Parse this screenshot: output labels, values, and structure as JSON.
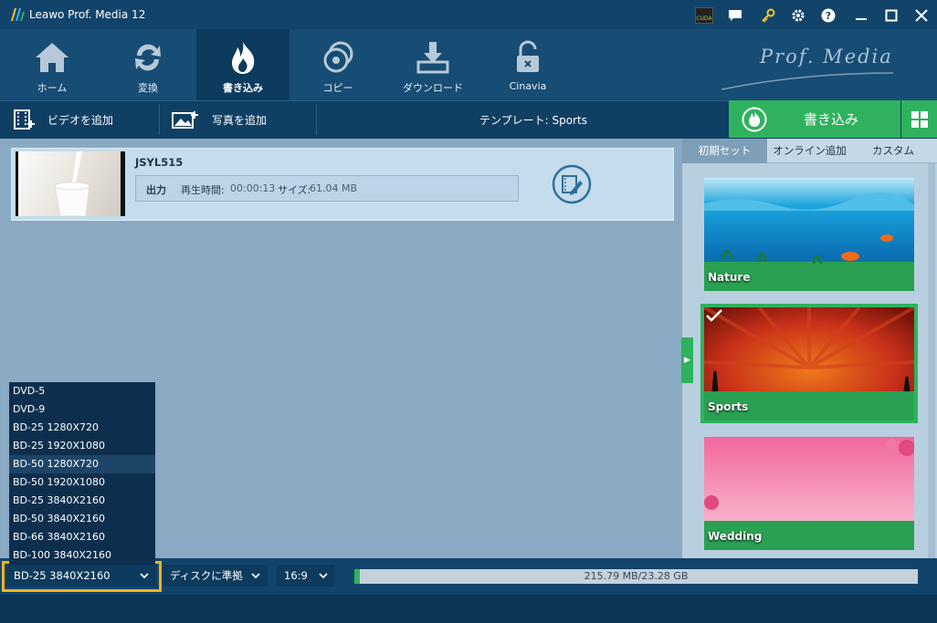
{
  "window": {
    "title": "Leawo Prof. Media 12",
    "cuda_label": "CUDA",
    "brand": "Prof. Media"
  },
  "nav": {
    "items": [
      {
        "label": "ホーム"
      },
      {
        "label": "変換"
      },
      {
        "label": "書き込み"
      },
      {
        "label": "コピー"
      },
      {
        "label": "ダウンロード"
      },
      {
        "label": "Cinavia"
      }
    ]
  },
  "toolbar": {
    "add_video": "ビデオを追加",
    "add_photo": "写真を追加",
    "template": "テンプレート: Sports",
    "burn": "書き込み"
  },
  "video": {
    "title": "JSYL515",
    "output_label": "出力",
    "duration_label": "再生時間:",
    "duration": "00:00:13",
    "size_label": "サイズ:",
    "size": "61.04 MB"
  },
  "dropdown": {
    "options": [
      "DVD-5",
      "DVD-9",
      "BD-25 1280X720",
      "BD-25 1920X1080",
      "BD-50 1280X720",
      "BD-50 1920X1080",
      "BD-25 3840X2160",
      "BD-50 3840X2160",
      "BD-66 3840X2160",
      "BD-100 3840X2160"
    ],
    "hovered": "BD-50 1280X720"
  },
  "sidebar": {
    "tabs": [
      "初期セット",
      "オンライン追加",
      "カスタム"
    ],
    "active_tab": "初期セット",
    "templates": [
      {
        "label": "Nature"
      },
      {
        "label": "Sports",
        "selected": true
      },
      {
        "label": "Wedding"
      }
    ]
  },
  "bottom": {
    "disc_type": "BD-25 3840X2160",
    "quality": "ディスクに準拠",
    "aspect": "16:9",
    "usage_text": "215.79 MB/23.28 GB",
    "usage_fraction": 0.0093
  },
  "colors": {
    "accent_green": "#2fb25e",
    "highlight_yellow": "#f2b21d",
    "nav_bg": "#174c74"
  }
}
